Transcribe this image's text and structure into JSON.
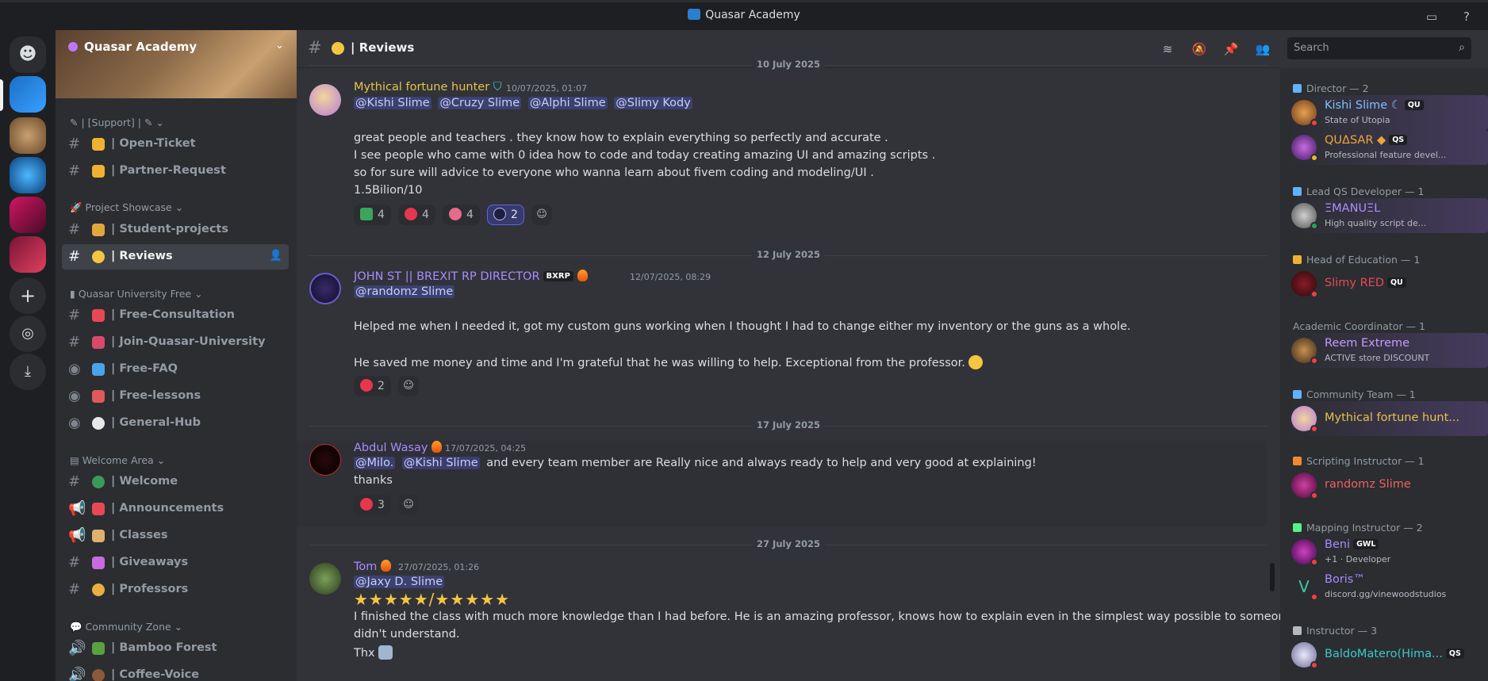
{
  "window": {
    "title": "Quasar Academy"
  },
  "server": {
    "name": "Quasar Academy"
  },
  "sidebar": {
    "categories": [
      {
        "label": "| [Support] |"
      },
      {
        "label": "Project Showcase"
      },
      {
        "label": "Quasar University Free"
      },
      {
        "label": "Welcome Area"
      },
      {
        "label": "Community Zone"
      }
    ],
    "channels": [
      {
        "label": "| Open-Ticket"
      },
      {
        "label": "| Partner-Request"
      },
      {
        "label": "| Student-projects"
      },
      {
        "label": "| Reviews"
      },
      {
        "label": "| Free-Consultation"
      },
      {
        "label": "| Join-Quasar-University"
      },
      {
        "label": "| Free-FAQ"
      },
      {
        "label": "| Free-lessons"
      },
      {
        "label": "| General-Hub"
      },
      {
        "label": "| Welcome"
      },
      {
        "label": "| Announcements"
      },
      {
        "label": "| Classes"
      },
      {
        "label": "| Giveaways"
      },
      {
        "label": "| Professors"
      },
      {
        "label": "| Bamboo Forest"
      },
      {
        "label": "| Coffee-Voice"
      }
    ]
  },
  "channel_header": {
    "name": "| Reviews"
  },
  "search": {
    "placeholder": "Search"
  },
  "dates": [
    "10 July 2025",
    "12 July 2025",
    "17 July 2025",
    "27 July 2025"
  ],
  "messages": [
    {
      "author": "Mythical fortune hunter",
      "timestamp": "10/07/2025, 01:07",
      "mentions": [
        "@Kishi Slime",
        "@Cruzy Slime",
        "@Alphi Slime",
        "@Slimy Kody"
      ],
      "lines": [
        "great people and teachers . they know how to explain everything so perfectly and accurate .",
        "I see people who came with 0 idea how to code and today creating amazing UI and amazing scripts .",
        "so for sure will advice to everyone who wanna learn about fivem coding and modeling/UI .",
        "1.5Bilion/10"
      ],
      "reactions": [
        "4",
        "4",
        "4",
        "2"
      ]
    },
    {
      "author": "JOHN ST || BREXIT RP DIRECTOR",
      "tag": "BXRP",
      "timestamp": "12/07/2025, 08:29",
      "mentions": [
        "@randomz Slime"
      ],
      "lines": [
        "Helped me when I needed it, got my custom guns working when I thought I had to change either my inventory or the guns as a whole.",
        "He saved me money and time and I'm grateful that he was willing to help. Exceptional from the professor."
      ],
      "reactions": [
        "2"
      ]
    },
    {
      "author": "Abdul Wasay",
      "timestamp": "17/07/2025, 04:25",
      "mentions": [
        "@Milo.",
        "@Kishi Slime"
      ],
      "text_after_mentions": "and every team member are Really nice  and always ready to help and very good at explaining!",
      "lines": [
        "thanks"
      ],
      "reactions": [
        "3"
      ]
    },
    {
      "author": "Tom",
      "timestamp": "27/07/2025, 01:26",
      "mentions": [
        "@Jaxy D. Slime"
      ],
      "stars": "★★★★★/★★★★★",
      "lines": [
        "I finished the class with much more knowledge than I had before. He is an amazing professor, knows how to explain even in the simplest way possible to someone who",
        "didn't understand.",
        "Thx"
      ]
    }
  ],
  "members": {
    "roles": [
      {
        "label": "Director — 2",
        "color": "#5fb3ff"
      },
      {
        "label": "Lead QS Developer — 1",
        "color": "#5fb3ff"
      },
      {
        "label": "Head of Education — 1",
        "color": "#f0b132"
      },
      {
        "label": "Academic Coordinator — 1",
        "color": "#949ba4"
      },
      {
        "label": "Community Team — 1",
        "color": "#5fb3ff"
      },
      {
        "label": "Scripting Instructor — 1",
        "color": "#f08a32"
      },
      {
        "label": "Mapping Instructor — 2",
        "color": "#57f287"
      },
      {
        "label": "Instructor — 3",
        "color": "#b5bac1"
      }
    ],
    "list": [
      {
        "name": "Kishi Slime",
        "tag": "QU",
        "sub": "State of Utopia",
        "color": "#7cc0ff"
      },
      {
        "name": "QUΔSAR",
        "tag": "QS",
        "sub": "Professional feature devel...",
        "color": "#f2a33a"
      },
      {
        "name": "ΞMANUΞL",
        "sub": "High quality script de...",
        "color": "#b08cff"
      },
      {
        "name": "Slimy RED",
        "tag": "QU",
        "color": "#e84855"
      },
      {
        "name": "Reem Extreme",
        "sub": "ACTIVE store DISCOUNT",
        "color": "#c49cff"
      },
      {
        "name": "Mythical fortune hunt...",
        "color": "#e7c14a"
      },
      {
        "name": "randomz Slime",
        "color": "#f06060"
      },
      {
        "name": "Beni",
        "tag": "GWL",
        "sub": "+1 · Developer",
        "color": "#a98bff"
      },
      {
        "name": "Boris™",
        "sub": "discord.gg/vinewoodstudios",
        "color": "#a98bff"
      },
      {
        "name": "BaldoMatero(Hima...",
        "tag": "QS",
        "color": "#3ec8c8"
      }
    ]
  }
}
